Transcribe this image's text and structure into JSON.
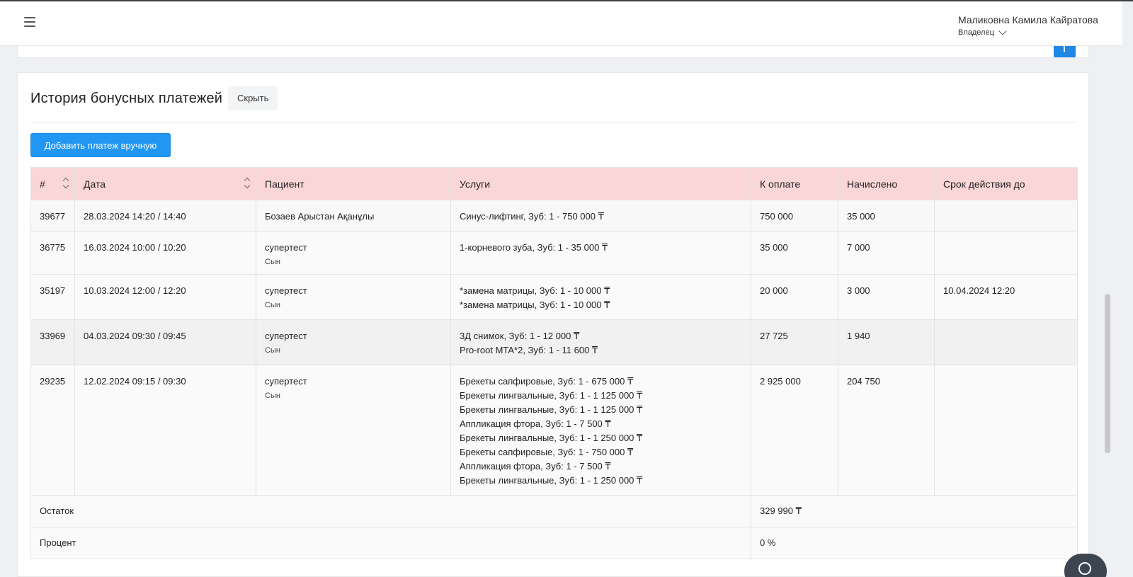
{
  "header": {
    "user_name": "Маликовна Камила Кайратова",
    "user_role": "Владелец"
  },
  "section": {
    "title": "История бонусных платежей",
    "hide_label": "Скрыть",
    "add_label": "Добавить платеж вручную"
  },
  "table": {
    "columns": [
      "#",
      "Дата",
      "Пациент",
      "Услуги",
      "К оплате",
      "Начислено",
      "Срок действия до"
    ],
    "rows": [
      {
        "id": "39677",
        "date": "28.03.2024 14:20 / 14:40",
        "patient": "Бозаев Арыстан Ақанұлы",
        "relation": "",
        "services": [
          "Синус-лифтинг, Зуб: 1 - 750 000 ₸"
        ],
        "to_pay": "750 000",
        "accrued": "35 000",
        "expires": ""
      },
      {
        "id": "36775",
        "date": "16.03.2024 10:00 / 10:20",
        "patient": "супертест",
        "relation": "Сын",
        "services": [
          "1-корневого зуба, Зуб: 1 - 35 000 ₸"
        ],
        "to_pay": "35 000",
        "accrued": "7 000",
        "expires": ""
      },
      {
        "id": "35197",
        "date": "10.03.2024 12:00 / 12:20",
        "patient": "супертест",
        "relation": "Сын",
        "services": [
          "*замена матрицы, Зуб: 1 - 10 000 ₸",
          "*замена матрицы, Зуб: 1 - 10 000 ₸"
        ],
        "to_pay": "20 000",
        "accrued": "3 000",
        "expires": "10.04.2024 12:20"
      },
      {
        "id": "33969",
        "date": "04.03.2024 09:30 / 09:45",
        "patient": "супертест",
        "relation": "Сын",
        "services": [
          "3Д снимок, Зуб: 1 - 12 000 ₸",
          "Pro-root MTA*2, Зуб: 1 - 11 600 ₸"
        ],
        "to_pay": "27 725",
        "accrued": "1 940",
        "expires": ""
      },
      {
        "id": "29235",
        "date": "12.02.2024 09:15 / 09:30",
        "patient": "супертест",
        "relation": "Сын",
        "services": [
          "Брекеты сапфировые, Зуб: 1 - 675 000 ₸",
          "Брекеты лингвальные, Зуб: 1 - 1 125 000 ₸",
          "Брекеты лингвальные, Зуб: 1 - 1 125 000 ₸",
          "Аппликация фтора, Зуб: 1 - 7 500 ₸",
          "Брекеты лингвальные, Зуб: 1 - 1 250 000 ₸",
          "Брекеты сапфировые, Зуб: 1 - 750 000 ₸",
          "Аппликация фтора, Зуб: 1 - 7 500 ₸",
          "Брекеты лингвальные, Зуб: 1 - 1 250 000 ₸"
        ],
        "to_pay": "2 925 000",
        "accrued": "204 750",
        "expires": ""
      }
    ],
    "footer": {
      "balance_label": "Остаток",
      "balance_value": "329 990 ₸",
      "percent_label": "Процент",
      "percent_value": "0 %"
    }
  }
}
